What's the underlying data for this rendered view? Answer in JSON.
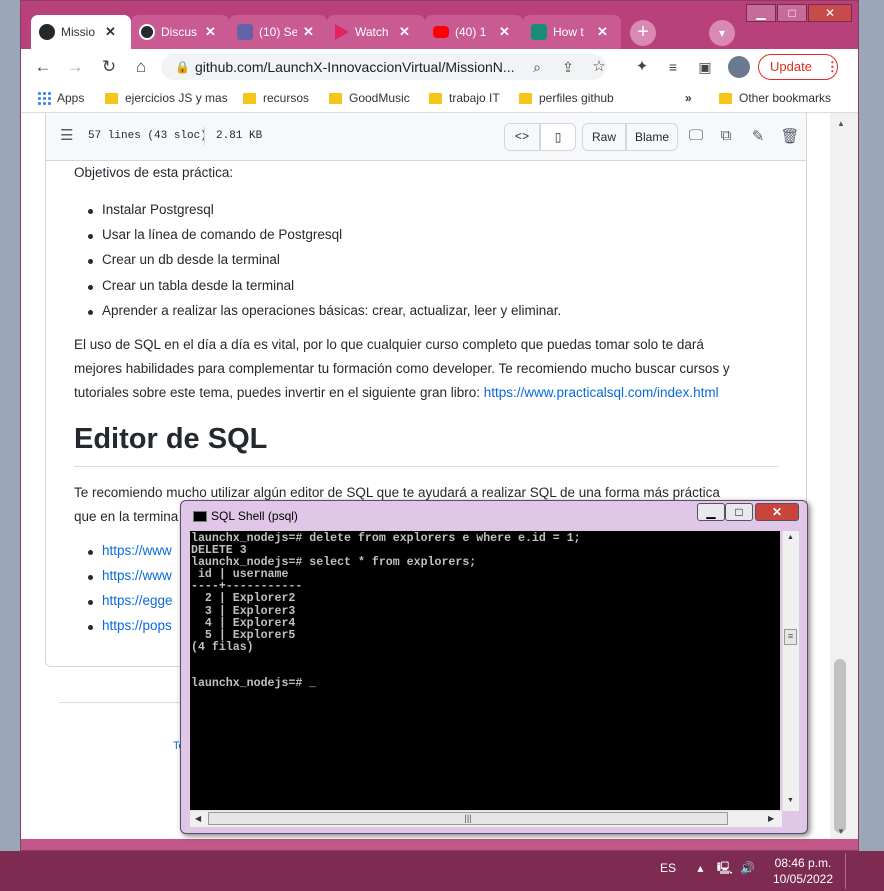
{
  "browser": {
    "tabs": [
      {
        "title": "Missio",
        "icon": "github-icon",
        "active": true
      },
      {
        "title": "Discus",
        "icon": "github-icon"
      },
      {
        "title": "(10) Se",
        "icon": "teams-icon"
      },
      {
        "title": "Watch",
        "icon": "play-icon"
      },
      {
        "title": "(40) 1",
        "icon": "youtube-icon"
      },
      {
        "title": "How t",
        "icon": "site-icon"
      }
    ],
    "url": "github.com/LaunchX-InnovaccionVirtual/MissionN...",
    "update_label": "Update",
    "bookmarks": [
      "Apps",
      "ejercicios JS y mas",
      "recursos",
      "GoodMusic",
      "trabajo IT",
      "perfiles github",
      "»",
      "Other bookmarks"
    ]
  },
  "file_header": {
    "lines": "57 lines (43 sloc)",
    "size": "2.81 KB",
    "raw_label": "Raw",
    "blame_label": "Blame"
  },
  "content": {
    "intro": "Objetivos de esta práctica:",
    "objectives": [
      "Instalar Postgresql",
      "Usar la línea de comando de Postgresql",
      "Crear un db desde la terminal",
      "Crear un tabla desde la terminal",
      "Aprender a realizar las operaciones básicas: crear, actualizar, leer y eliminar."
    ],
    "para_line1": "El uso de SQL en el día a día es vital, por lo que cualquier curso completo que puedas tomar solo te dará",
    "para_line2": "mejores habilidades para complementar tu formación como developer. Te recomiendo mucho buscar cursos y",
    "para_line3_text": "tutoriales sobre este tema, puedes invertir en el siguiente gran libro: ",
    "para_link": "https://www.practicalsql.com/index.html",
    "heading": "Editor de SQL",
    "editor_line1": "Te recomiendo mucho utilizar algún editor de SQL que te ayudará a realizar SQL de una forma más práctica",
    "editor_line2": "que en la termina",
    "links": [
      "https://www",
      "https://www",
      "https://egge",
      "https://pops"
    ],
    "footer_fragment": "Te"
  },
  "sql_shell": {
    "title": "SQL Shell (psql)",
    "output": "launchx_nodejs=# delete from explorers e where e.id = 1;\nDELETE 3\nlaunchx_nodejs=# select * from explorers;\n id | username\n----+-----------\n  2 | Explorer2\n  3 | Explorer3\n  4 | Explorer4\n  5 | Explorer5\n(4 filas)\n\n\nlaunchx_nodejs=# _"
  },
  "taskbar": {
    "lang": "ES",
    "time": "08:46 p.m.",
    "date": "10/05/2022"
  },
  "colors": {
    "chrome_frame": "#c2578a",
    "tab_strip": "#b8407b",
    "link": "#0969da",
    "update": "#d93025",
    "taskbar": "#7d2b50"
  }
}
